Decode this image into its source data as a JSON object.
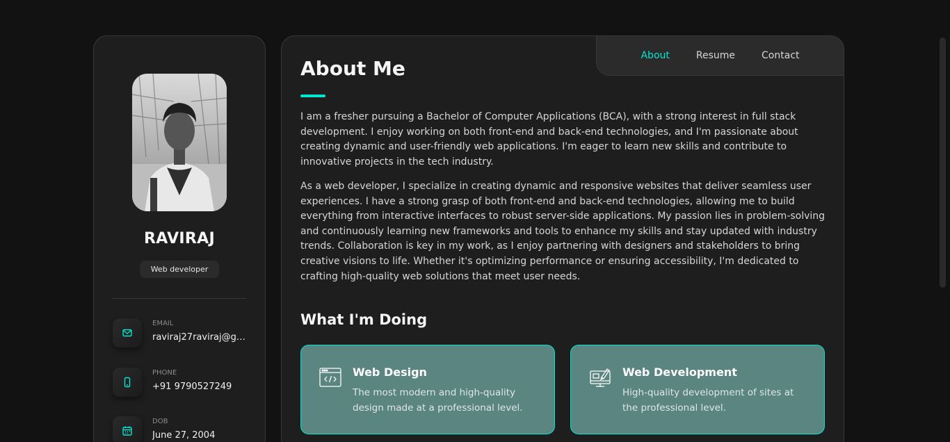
{
  "sidebar": {
    "name": "RAVIRAJ",
    "role": "Web developer",
    "contacts": [
      {
        "title": "Email",
        "value": "raviraj27raviraj@gm...",
        "icon": "mail-icon"
      },
      {
        "title": "Phone",
        "value": "+91 9790527249",
        "icon": "phone-icon"
      },
      {
        "title": "DOB",
        "value": "June 27, 2004",
        "icon": "calendar-icon"
      }
    ]
  },
  "nav": {
    "items": [
      "About",
      "Resume",
      "Contact"
    ],
    "active": "About"
  },
  "about": {
    "title": "About Me",
    "paragraphs": [
      "I am a fresher pursuing a Bachelor of Computer Applications (BCA), with a strong interest in full stack development. I enjoy working on both front-end and back-end technologies, and I'm passionate about creating dynamic and user-friendly web applications. I'm eager to learn new skills and contribute to innovative projects in the tech industry.",
      "As a web developer, I specialize in creating dynamic and responsive websites that deliver seamless user experiences. I have a strong grasp of both front-end and back-end technologies, allowing me to build everything from interactive interfaces to robust server-side applications. My passion lies in problem-solving and continuously learning new frameworks and tools to enhance my skills and stay updated with industry trends. Collaboration is key in my work, as I enjoy partnering with designers and stakeholders to bring creative visions to life. Whether it's optimizing performance or ensuring accessibility, I'm dedicated to crafting high-quality web solutions that meet user needs."
    ]
  },
  "services": {
    "title": "What I'm Doing",
    "items": [
      {
        "title": "Web Design",
        "text": "The most modern and high-quality design made at a professional level.",
        "icon": "web-design-icon"
      },
      {
        "title": "Web Development",
        "text": "High-quality development of sites at the professional level.",
        "icon": "web-development-icon"
      }
    ]
  },
  "colors": {
    "accent": "#00e5d1",
    "background": "#121212",
    "card": "#1e1e1f",
    "service_card": "#5a8580"
  }
}
